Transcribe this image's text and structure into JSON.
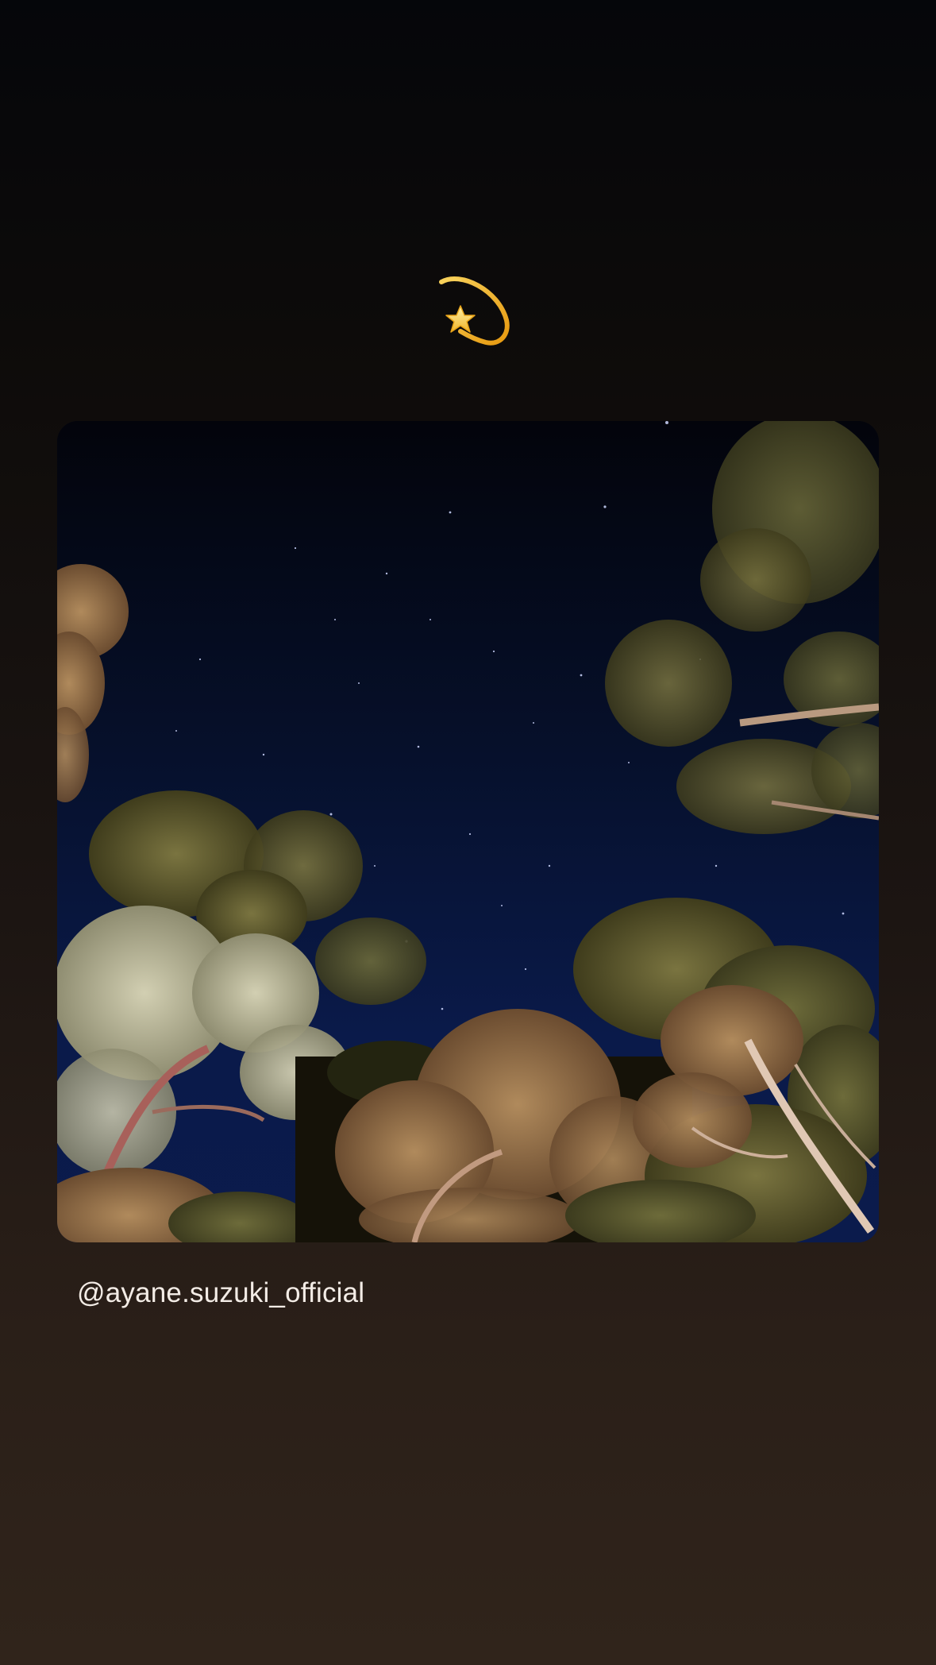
{
  "story": {
    "sticker_icon": "dizzy-star-emoji-icon",
    "photo": {
      "subject": "night-sky-photo",
      "colors": {
        "sky_top": "#04050e",
        "sky_bottom": "#0b1a48",
        "foliage_warm": "#8a6a46",
        "foliage_green": "#5a5a30",
        "foliage_pale": "#b9b79a"
      }
    },
    "mention": {
      "username": "@ayane.suzuki_official"
    }
  },
  "colors": {
    "background_top": "#05060a",
    "background_bottom": "#30241b",
    "text": "#f3ece6",
    "sticker_gold": "#f2b320"
  }
}
